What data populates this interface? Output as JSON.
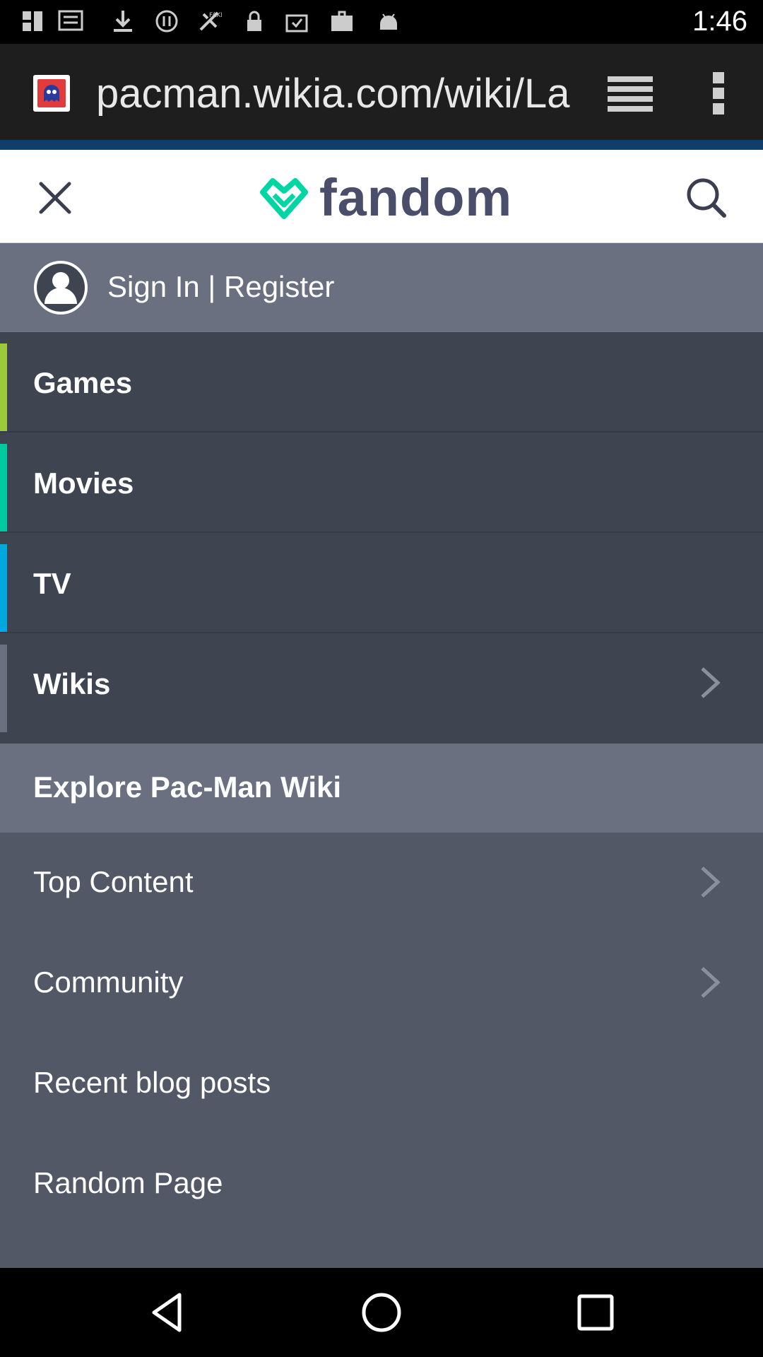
{
  "status_bar": {
    "time": "1:46",
    "icons": [
      "notification-icon",
      "download-icon",
      "sync-icon",
      "fake-gps-icon",
      "lock-icon",
      "clipboard-icon",
      "briefcase-icon",
      "android-icon"
    ]
  },
  "browser": {
    "url": "pacman.wikia.com/wiki/Las",
    "favicon": "pacman-ghost-icon",
    "reader_icon": "reader-mode-icon",
    "menu_icon": "more-vert-icon"
  },
  "header": {
    "logo_text": "fandom",
    "close_icon": "close-icon",
    "search_icon": "search-icon"
  },
  "menu": {
    "signin_label": "Sign In | Register",
    "categories": [
      {
        "label": "Games",
        "color": "#9bcb3c"
      },
      {
        "label": "Movies",
        "color": "#00c8a0"
      },
      {
        "label": "TV",
        "color": "#00a8e0"
      },
      {
        "label": "Wikis",
        "color": "#6a7080"
      }
    ],
    "explore_label": "Explore Pac-Man Wiki",
    "sub_items": [
      {
        "label": "Top Content"
      },
      {
        "label": "Community"
      },
      {
        "label": "Recent blog posts"
      },
      {
        "label": "Random Page"
      }
    ]
  },
  "colors": {
    "brand_green": "#00d6a3",
    "brand_navy": "#4a4e6a",
    "panel_bg": "#525866"
  }
}
